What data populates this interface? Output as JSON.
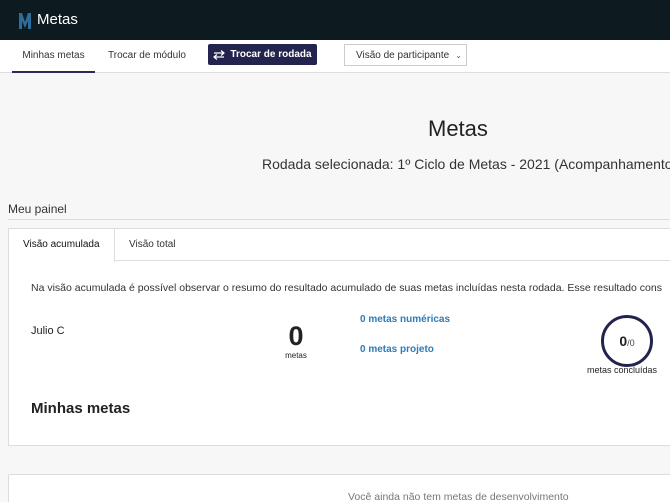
{
  "app": {
    "title": "Metas"
  },
  "nav": {
    "tabs": [
      {
        "label": "Minhas metas"
      },
      {
        "label": "Trocar de módulo"
      }
    ],
    "rodada_button": "Trocar de rodada",
    "visao_select": "Visão de participante"
  },
  "header": {
    "title": "Metas",
    "rodada": "Rodada selecionada: 1º Ciclo de Metas - 2021 (Acompanhamento)"
  },
  "painel": {
    "title": "Meu painel",
    "tabs": [
      {
        "label": "Visão acumulada"
      },
      {
        "label": "Visão total"
      }
    ],
    "description": "Na visão acumulada é possível observar o resumo do resultado acumulado de suas metas incluídas nesta rodada. Esse resultado cons",
    "user_name": "Julio C",
    "metas_count": "0",
    "metas_label": "metas",
    "numericas_link": "0 metas numéricas",
    "projeto_link": "0 metas projeto",
    "concluidas_num": "0",
    "concluidas_den": "/0",
    "concluidas_label": "metas concluídas",
    "minhas_title": "Minhas metas"
  },
  "empty_state": {
    "text": "Você ainda não tem metas de desenvolvimento"
  },
  "colors": {
    "topbar": "#0d1a1f",
    "accent": "#23244d",
    "link": "#2f7bb5"
  }
}
